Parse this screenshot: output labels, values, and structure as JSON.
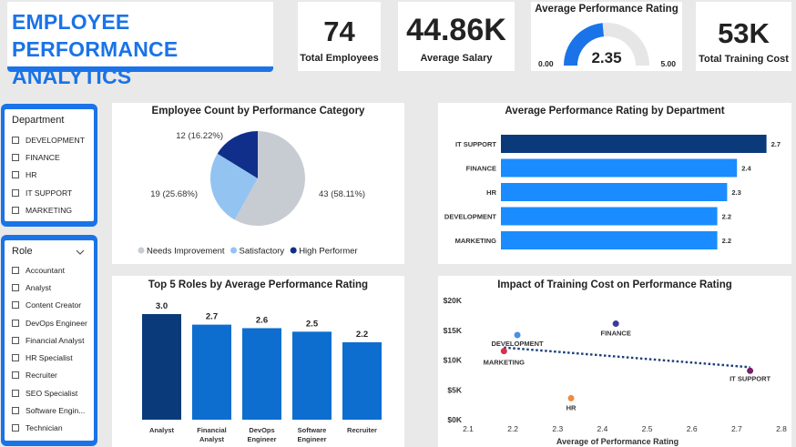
{
  "header": {
    "title_line1": "EMPLOYEE PERFORMANCE",
    "title_line2": "ANALYTICS"
  },
  "kpis": {
    "employees": {
      "value": "74",
      "label": "Total Employees"
    },
    "salary": {
      "value": "44.86K",
      "label": "Average Salary"
    },
    "rating": {
      "title": "Average Performance Rating",
      "value": "2.35",
      "min": "0.00",
      "max": "5.00",
      "fraction": 0.47
    },
    "training": {
      "value": "53K",
      "label": "Total Training Cost"
    }
  },
  "slicers": {
    "department": {
      "title": "Department",
      "items": [
        "DEVELOPMENT",
        "FINANCE",
        "HR",
        "IT SUPPORT",
        "MARKETING"
      ]
    },
    "role": {
      "title": "Role",
      "items": [
        "Accountant",
        "Analyst",
        "Content Creator",
        "DevOps Engineer",
        "Financial Analyst",
        "HR Specialist",
        "Recruiter",
        "SEO Specialist",
        "Software Engin...",
        "Technician"
      ]
    }
  },
  "colors": {
    "accent": "#1a73e8",
    "dark_navy": "#0a3a7a",
    "pie_needs": "#c7ccd3",
    "pie_satisfactory": "#93c4f1",
    "pie_high": "#0f2f8a"
  },
  "chart_data": [
    {
      "type": "pie",
      "title": "Employee Count by Performance Category",
      "slices": [
        {
          "name": "Needs Improvement",
          "value": 43,
          "label": "43 (58.11%)",
          "color": "#c7ccd3"
        },
        {
          "name": "Satisfactory",
          "value": 19,
          "label": "19 (25.68%)",
          "color": "#93c4f1"
        },
        {
          "name": "High Performer",
          "value": 12,
          "label": "12 (16.22%)",
          "color": "#0f2f8a"
        }
      ],
      "legend": [
        "Needs Improvement",
        "Satisfactory",
        "High Performer"
      ],
      "legend_position": "bottom"
    },
    {
      "type": "bar",
      "orientation": "horizontal",
      "title": "Average Performance Rating by Department",
      "categories": [
        "IT SUPPORT",
        "FINANCE",
        "HR",
        "DEVELOPMENT",
        "MARKETING"
      ],
      "values": [
        2.7,
        2.4,
        2.3,
        2.2,
        2.2
      ],
      "value_labels": [
        "2.7",
        "2.4",
        "2.3",
        "2.2",
        "2.2"
      ],
      "xlim": [
        0,
        2.75
      ]
    },
    {
      "type": "bar",
      "title": "Top 5 Roles by Average Performance Rating",
      "categories": [
        "Analyst",
        "Financial Analyst",
        "DevOps Engineer",
        "Software Engineer",
        "Recruiter"
      ],
      "category_lines": [
        [
          "Analyst"
        ],
        [
          "Financial",
          "Analyst"
        ],
        [
          "DevOps",
          "Engineer"
        ],
        [
          "Software",
          "Engineer"
        ],
        [
          "Recruiter"
        ]
      ],
      "values": [
        3.0,
        2.7,
        2.6,
        2.5,
        2.2
      ],
      "value_labels": [
        "3.0",
        "2.7",
        "2.6",
        "2.5",
        "2.2"
      ],
      "ylim": [
        0,
        3.0
      ]
    },
    {
      "type": "scatter",
      "title": "Impact of Training Cost on Performance Rating",
      "xlabel": "Average of Performance Rating",
      "ylabel": "",
      "xlim": [
        2.1,
        2.8
      ],
      "ylim": [
        0,
        20000
      ],
      "xticks": [
        "2.1",
        "2.2",
        "2.3",
        "2.4",
        "2.5",
        "2.6",
        "2.7",
        "2.8"
      ],
      "yticks": [
        "$0K",
        "$5K",
        "$10K",
        "$15K",
        "$20K"
      ],
      "points": [
        {
          "name": "DEVELOPMENT",
          "x": 2.21,
          "y": 14200,
          "color": "#4a90e2"
        },
        {
          "name": "FINANCE",
          "x": 2.43,
          "y": 16100,
          "color": "#3b3b9e"
        },
        {
          "name": "MARKETING",
          "x": 2.18,
          "y": 11500,
          "color": "#d9304a"
        },
        {
          "name": "HR",
          "x": 2.33,
          "y": 3600,
          "color": "#f08a3e"
        },
        {
          "name": "IT SUPPORT",
          "x": 2.73,
          "y": 8200,
          "color": "#7a1f6a"
        }
      ],
      "trend": {
        "x1": 2.18,
        "y1": 12100,
        "x2": 2.73,
        "y2": 8800
      }
    }
  ]
}
